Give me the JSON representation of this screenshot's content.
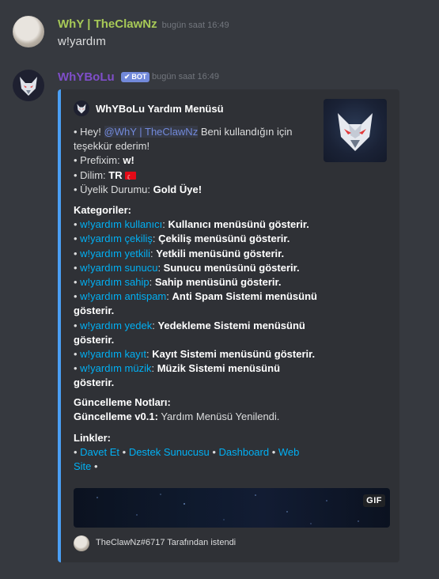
{
  "messages": {
    "user": {
      "name": "WhY | TheClawNz",
      "timestamp": "bugün saat 16:49",
      "text": "w!yardım"
    },
    "bot": {
      "name": "WhYBoLu",
      "badge": "BOT",
      "timestamp": "bugün saat 16:49"
    }
  },
  "embed": {
    "accent_color": "#4a9ff5",
    "author": "WhYBoLu Yardım Menüsü",
    "description": {
      "hey_prefix": "• Hey! ",
      "mention": "@WhY | TheClawNz",
      "hey_suffix": " Beni kullandığın için teşekkür ederim!",
      "prefix_label": "• Prefixim: ",
      "prefix_value": "w!",
      "lang_label": "• Dilim: ",
      "lang_value": "TR",
      "membership_label": "• Üyelik Durumu: ",
      "membership_value": "Gold Üye!"
    },
    "categories_title": "Kategoriler:",
    "categories": [
      {
        "command": "w!yardım kullanıcı",
        "desc": "Kullanıcı menüsünü gösterir."
      },
      {
        "command": "w!yardım çekiliş",
        "desc": "Çekiliş menüsünü gösterir."
      },
      {
        "command": "w!yardım yetkili",
        "desc": "Yetkili menüsünü gösterir."
      },
      {
        "command": "w!yardım sunucu",
        "desc": "Sunucu menüsünü gösterir."
      },
      {
        "command": "w!yardım sahip",
        "desc": "Sahip menüsünü gösterir."
      },
      {
        "command": "w!yardım antispam",
        "desc": "Anti Spam Sistemi menüsünü gösterir."
      },
      {
        "command": "w!yardım yedek",
        "desc": "Yedekleme Sistemi menüsünü gösterir."
      },
      {
        "command": "w!yardım kayıt",
        "desc": "Kayıt Sistemi menüsünü gösterir."
      },
      {
        "command": "w!yardım müzik",
        "desc": "Müzik Sistemi menüsünü gösterir."
      }
    ],
    "update_title": "Güncelleme Notları:",
    "update_version": "Güncelleme v0.1:",
    "update_text": " Yardım Menüsü Yenilendi.",
    "links_title": "Linkler:",
    "links": [
      "Davet Et",
      "Destek Sunucusu",
      "Dashboard",
      "Web Site"
    ],
    "image_badge": "GIF",
    "footer": "TheClawNz#6717 Tarafından istendi"
  }
}
